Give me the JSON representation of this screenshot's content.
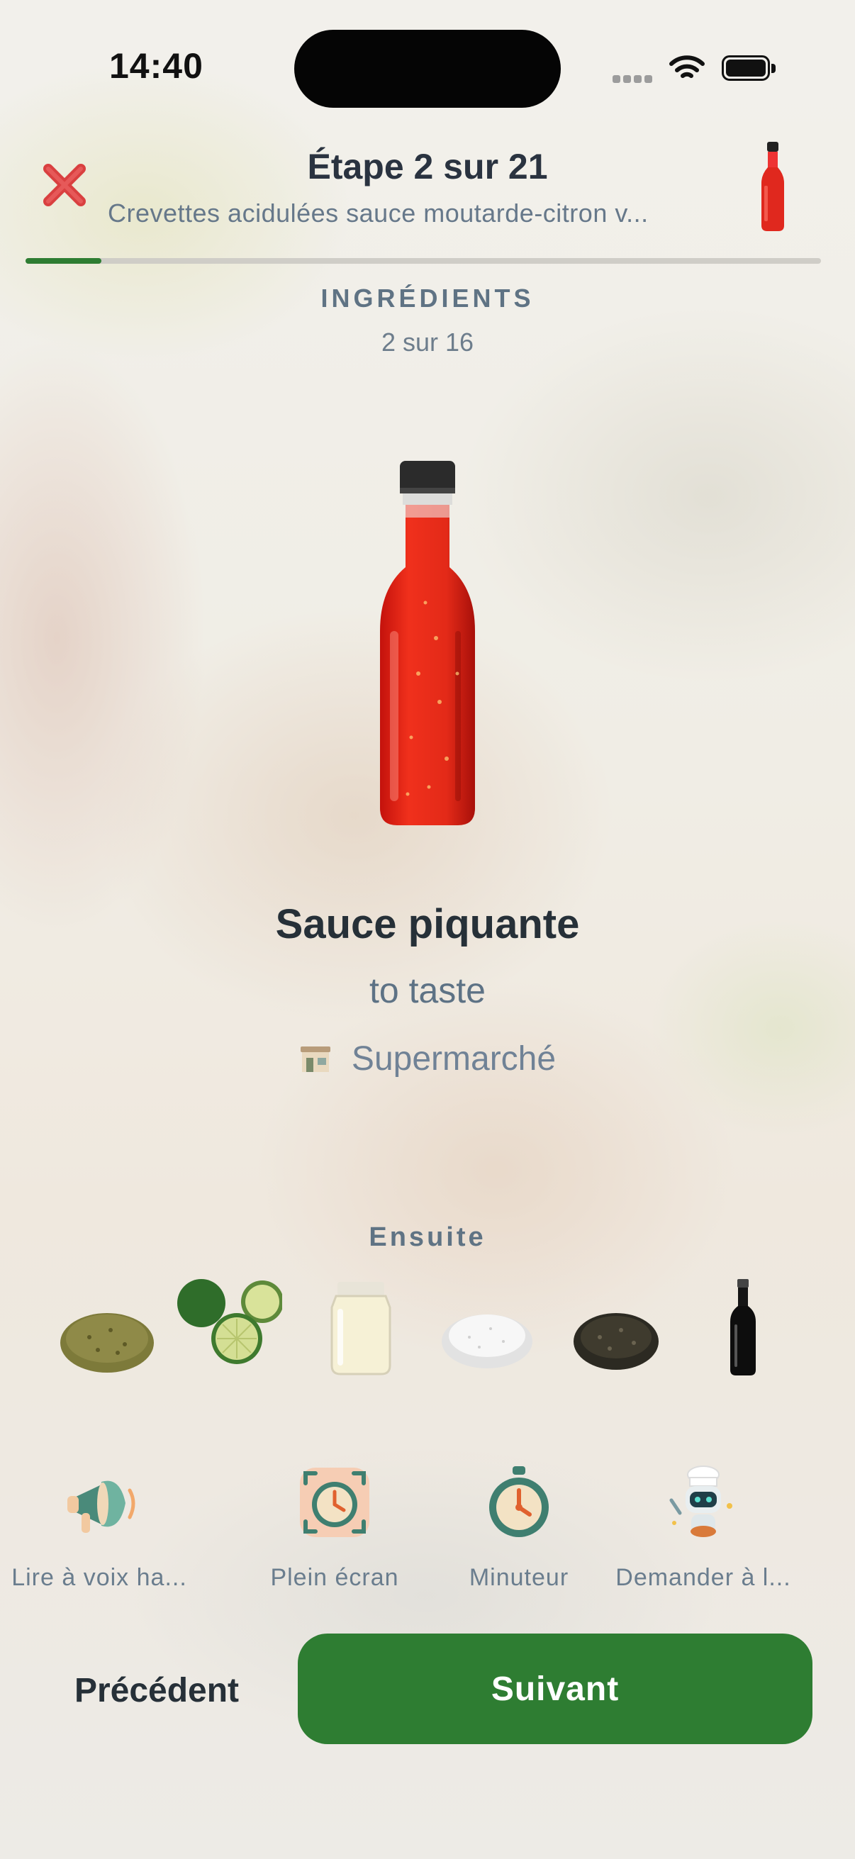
{
  "status_bar": {
    "time": "14:40"
  },
  "header": {
    "step_title": "Étape 2 sur 21",
    "recipe_title": "Crevettes acidulées sauce moutarde-citron v...",
    "close_icon": "close-x-icon",
    "thumbnail": "hot-sauce-bottle"
  },
  "progress": {
    "current_step": 2,
    "total_steps": 21,
    "fraction": 0.095,
    "color": "#2e7d32"
  },
  "section": {
    "label": "INGRÉDIENTS",
    "count": "2 sur 16"
  },
  "ingredient": {
    "name": "Sauce piquante",
    "quantity": "to taste",
    "store": "Supermarché",
    "image": "hot-sauce-bottle",
    "store_icon": "store-icon"
  },
  "next_section": {
    "label": "Ensuite",
    "items": [
      "dried-herbs",
      "limes",
      "mayonnaise-jar",
      "salt",
      "black-pepper",
      "soy-sauce-bottle"
    ]
  },
  "tools": [
    {
      "label": "Lire à voix ha...",
      "icon": "megaphone-icon"
    },
    {
      "label": "Plein écran",
      "icon": "fullscreen-timer-icon"
    },
    {
      "label": "Minuteur",
      "icon": "stopwatch-icon"
    },
    {
      "label": "Demander à l...",
      "icon": "robot-chef-icon"
    }
  ],
  "nav": {
    "prev_label": "Précédent",
    "next_label": "Suivant",
    "accent": "#2e7d32"
  }
}
